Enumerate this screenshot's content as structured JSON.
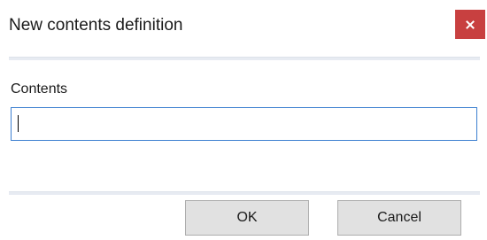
{
  "dialog": {
    "title": "New contents definition",
    "close_symbol": "×",
    "close_icon": "close-icon"
  },
  "form": {
    "label": "Contents",
    "value": "",
    "placeholder": ""
  },
  "buttons": {
    "ok_label": "OK",
    "cancel_label": "Cancel"
  },
  "colors": {
    "close_button_bg": "#c84040",
    "input_border_focus": "#3c7fd0",
    "button_bg": "#e1e1e1"
  }
}
